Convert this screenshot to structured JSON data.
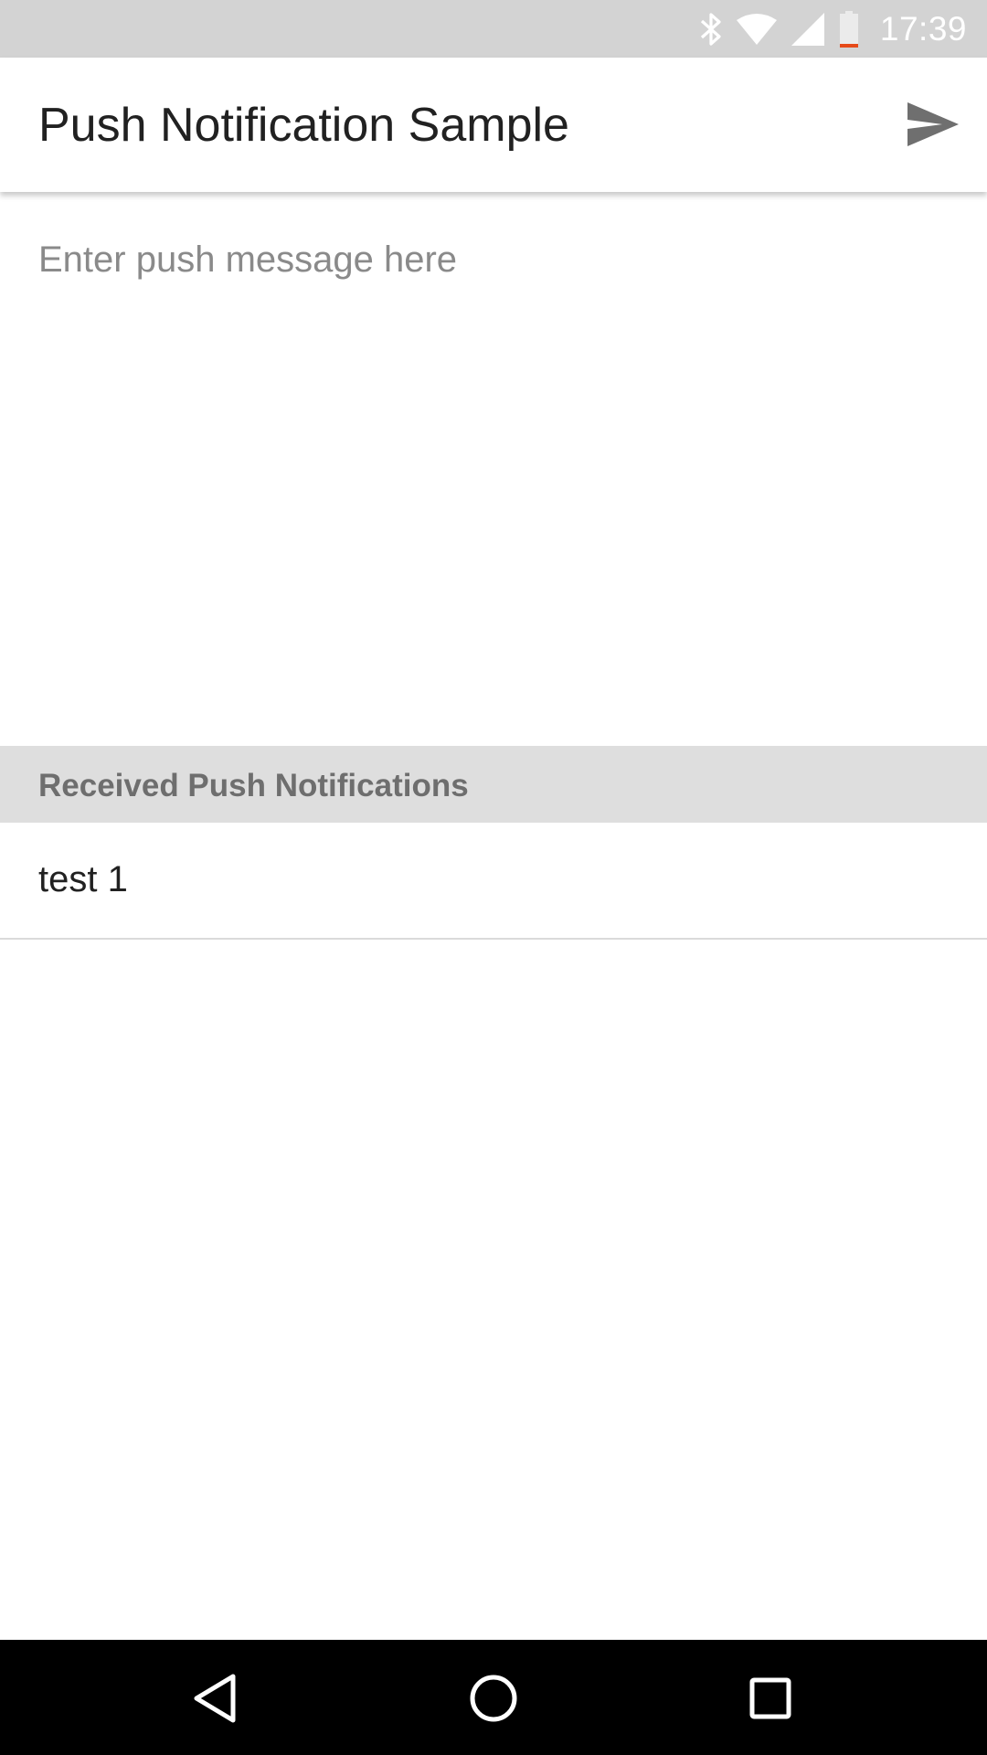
{
  "status_bar": {
    "time": "17:39",
    "icons": [
      "bluetooth-icon",
      "wifi-icon",
      "cell-signal-icon",
      "battery-low-icon"
    ],
    "battery_alert_color": "#e64a19"
  },
  "app_bar": {
    "title": "Push Notification Sample",
    "send_icon": "send-icon"
  },
  "message": {
    "placeholder": "Enter push message here",
    "value": ""
  },
  "received": {
    "header": "Received Push Notifications",
    "items": [
      {
        "text": "test 1"
      }
    ]
  },
  "nav_bar": {
    "buttons": [
      "back-icon",
      "home-icon",
      "recents-icon"
    ]
  }
}
